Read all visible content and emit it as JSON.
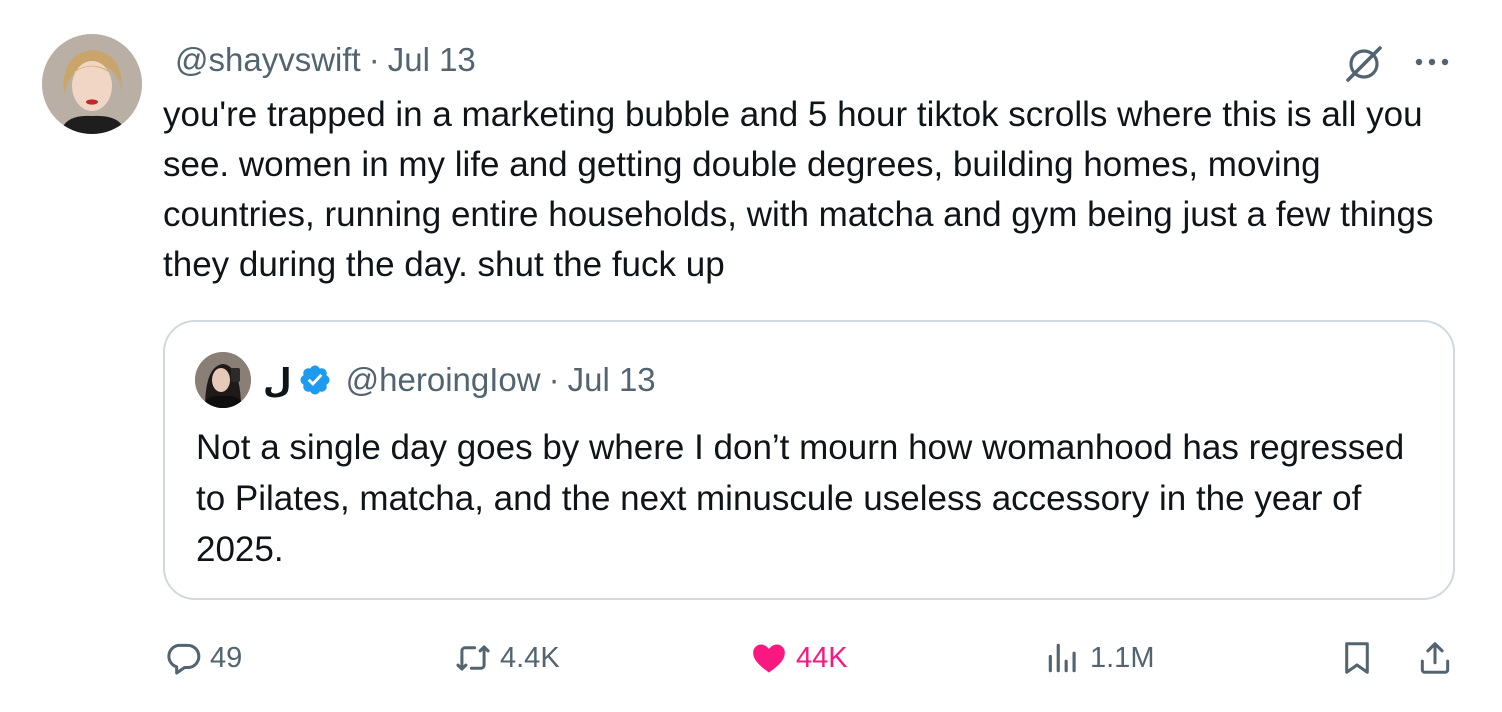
{
  "post": {
    "handle": "@shayvswift",
    "separator": "·",
    "date": "Jul 13",
    "text": "you're trapped in a marketing bubble and 5 hour tiktok scrolls where this is all you see. women in my life and getting double degrees, building homes, moving countries, running entire households, with matcha and gym being just a few things they during the day. shut the fuck up"
  },
  "quote": {
    "name": "ل",
    "handle": "@heroingIow",
    "separator": "·",
    "date": "Jul 13",
    "text": "Not a single day goes by where I don’t mourn how womanhood has regressed to Pilates, matcha, and the next minuscule useless accessory in the year of 2025."
  },
  "actions": {
    "replies": "49",
    "reposts": "4.4K",
    "likes": "44K",
    "views": "1.1M"
  },
  "colors": {
    "text": "#0f1419",
    "secondary": "#536471",
    "like": "#f91880",
    "verified": "#1d9bf0",
    "border": "#cfd9de"
  },
  "icons": [
    "grok-icon",
    "more-icon",
    "verified-icon",
    "reply-icon",
    "repost-icon",
    "heart-icon",
    "views-icon",
    "bookmark-icon",
    "share-icon"
  ]
}
